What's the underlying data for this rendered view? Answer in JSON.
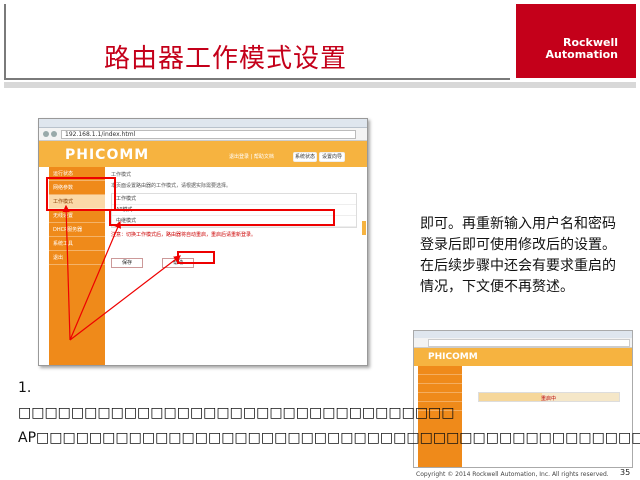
{
  "slide": {
    "title": "路由器工作模式设置",
    "brand_line1": "Rockwell",
    "brand_line2": "Automation",
    "accent_color": "#c4001a"
  },
  "main_screenshot": {
    "address": "192.168.1.1/index.html",
    "brand": "PHICOMM",
    "top_link": "退出登录 | 帮助文档",
    "top_buttons": [
      "系统状态",
      "设置向导"
    ],
    "sidebar": [
      "运行状态",
      "网络参数",
      "工作模式",
      "无线设置",
      "DHCP服务器",
      "系统工具",
      "退出"
    ],
    "active_sidebar_index": 2,
    "content_heading": "工作模式",
    "content_intro": "本页面设置路由器的工作模式，请根据实际需要选择。",
    "table_rows": [
      "工作模式",
      "AP模式",
      "中继模式"
    ],
    "warning": "注意：切换工作模式后，路由器将自动重启，重启后请重新登录。",
    "buttons": [
      "保存",
      "帮助"
    ]
  },
  "side_text": "即可。再重新输入用户名和密码登录后即可使用修改后的设置。在后续步骤中还会有要求重启的情况，下文便不再赘述。",
  "second_screenshot": {
    "brand": "PHICOMM",
    "progress_label": "重启中",
    "progress": 0.45
  },
  "caption": "1. □□□□□□□□□□□□□□□□□□□□□□□□□□□□□□□□□ AP□□□□□□□□□□□□□□□□□□□□□□□□□□□□□□□□□□□□□□□□□□□□□□",
  "footer": {
    "copyright": "Copyright © 2014 Rockwell Automation, Inc. All rights reserved.",
    "page": "35"
  }
}
